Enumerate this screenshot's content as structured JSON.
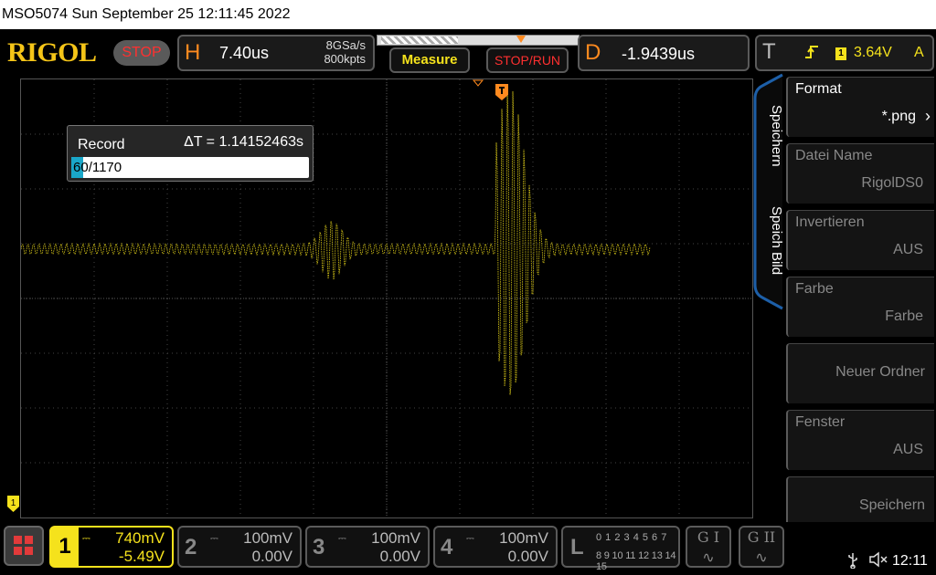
{
  "titlebar": {
    "text": "MSO5074  Sun September 25 12:11:45 2022"
  },
  "header": {
    "logo": "RIGOL",
    "run_state": "STOP",
    "horizontal": {
      "letter": "H",
      "timebase": "7.40us",
      "sample_rate": "8GSa/s",
      "memory_depth": "800kpts"
    },
    "measure_label": "Measure",
    "stoprun_label": "STOP/RUN",
    "delay": {
      "letter": "D",
      "value": "-1.9439us"
    },
    "trigger": {
      "letter": "T",
      "edge_icon": "rising-edge-icon",
      "channel": "1",
      "level": "3.64V",
      "mode": "A"
    }
  },
  "record": {
    "title": "Record",
    "delta_t": "ΔT = 1.14152463s",
    "current_frame": "60",
    "total_frames": "/1170",
    "progress_fraction": 0.051
  },
  "side_tabs": [
    "Speichern",
    "Speich Bild"
  ],
  "menu": [
    {
      "label": "Format",
      "value": "*.png",
      "enabled": true,
      "has_arrow": true
    },
    {
      "label": "Datei Name",
      "value": "RigolDS0",
      "enabled": false
    },
    {
      "label": "Invertieren",
      "value": "AUS",
      "enabled": false
    },
    {
      "label": "Farbe",
      "value": "Farbe",
      "enabled": false
    },
    {
      "label": "",
      "value": "Neuer Ordner",
      "enabled": false
    },
    {
      "label": "Fenster",
      "value": "AUS",
      "enabled": false
    },
    {
      "label": "",
      "value": "Speichern",
      "enabled": false
    }
  ],
  "channels": [
    {
      "num": "1",
      "scale": "740mV",
      "offset": "-5.49V",
      "active": true
    },
    {
      "num": "2",
      "scale": "100mV",
      "offset": "0.00V",
      "active": false
    },
    {
      "num": "3",
      "scale": "100mV",
      "offset": "0.00V",
      "active": false
    },
    {
      "num": "4",
      "scale": "100mV",
      "offset": "0.00V",
      "active": false
    }
  ],
  "logic": {
    "letter": "L",
    "row1": "0 1 2 3   4 5 6 7",
    "row2": "8 9 10 11  12 13 14 15"
  },
  "generators": [
    "G I",
    "G II"
  ],
  "status": {
    "clock": "12:11",
    "usb_icon": "usb-icon",
    "speaker_icon": "speaker-muted-icon"
  },
  "colors": {
    "ch1": "#f5e21c",
    "accent_orange": "#ff8a1f",
    "stop_red": "#ff3030",
    "record_fill": "#1aa7c9"
  }
}
